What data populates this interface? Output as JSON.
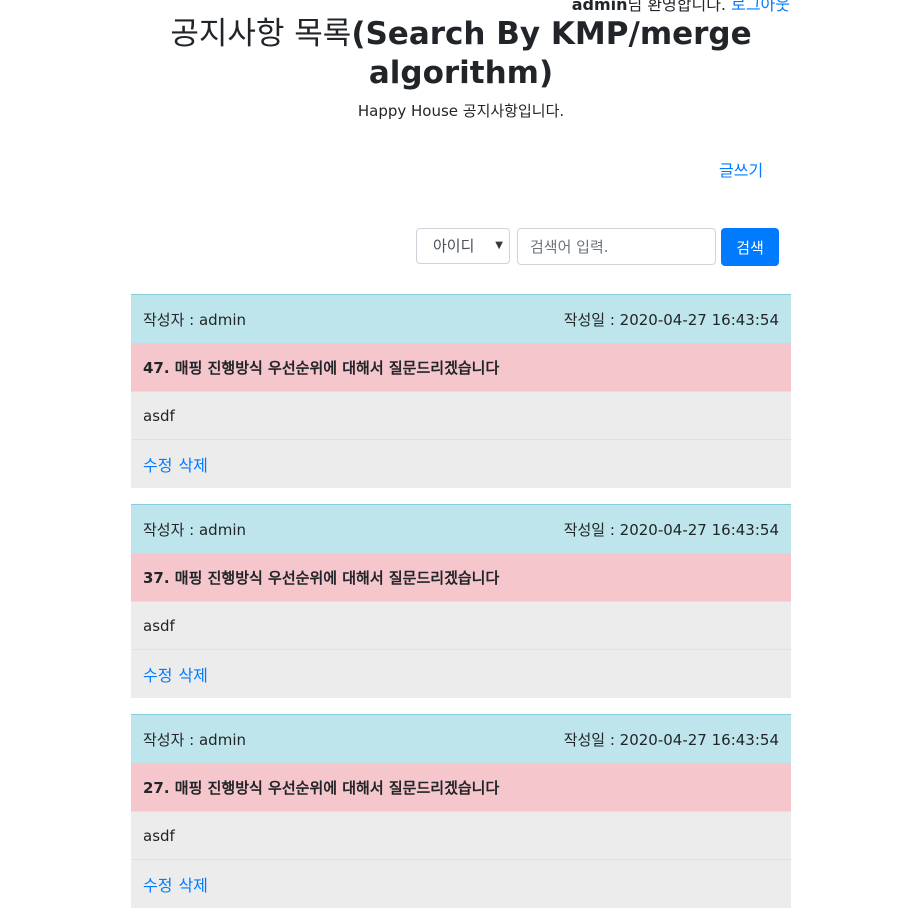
{
  "topbar": {
    "username": "admin",
    "welcome_suffix": "님 환영합니다.",
    "logout_label": "로그아웃"
  },
  "header": {
    "title_korean": "공지사항 목록",
    "title_english": "(Search By KMP/merge algorithm)",
    "subtitle": "Happy House 공지사항입니다."
  },
  "actions": {
    "write_label": "글쓰기"
  },
  "search": {
    "selected_option": "아이디",
    "placeholder": "검색어 입력.",
    "button_label": "검색"
  },
  "notices": [
    {
      "author_label": "작성자 : admin",
      "date_label": "작성일 : 2020-04-27 16:43:54",
      "subject": "47. 매핑 진행방식 우선순위에 대해서 질문드리겠습니다",
      "content": "asdf",
      "edit_label": "수정",
      "delete_label": "삭제"
    },
    {
      "author_label": "작성자 : admin",
      "date_label": "작성일 : 2020-04-27 16:43:54",
      "subject": "37. 매핑 진행방식 우선순위에 대해서 질문드리겠습니다",
      "content": "asdf",
      "edit_label": "수정",
      "delete_label": "삭제"
    },
    {
      "author_label": "작성자 : admin",
      "date_label": "작성일 : 2020-04-27 16:43:54",
      "subject": "27. 매핑 진행방식 우선순위에 대해서 질문드리겠습니다",
      "content": "asdf",
      "edit_label": "수정",
      "delete_label": "삭제"
    }
  ],
  "colors": {
    "link": "#007bff",
    "info_bg": "#bee5eb",
    "danger_bg": "#f5c6cb",
    "row_bg": "#ececec"
  }
}
